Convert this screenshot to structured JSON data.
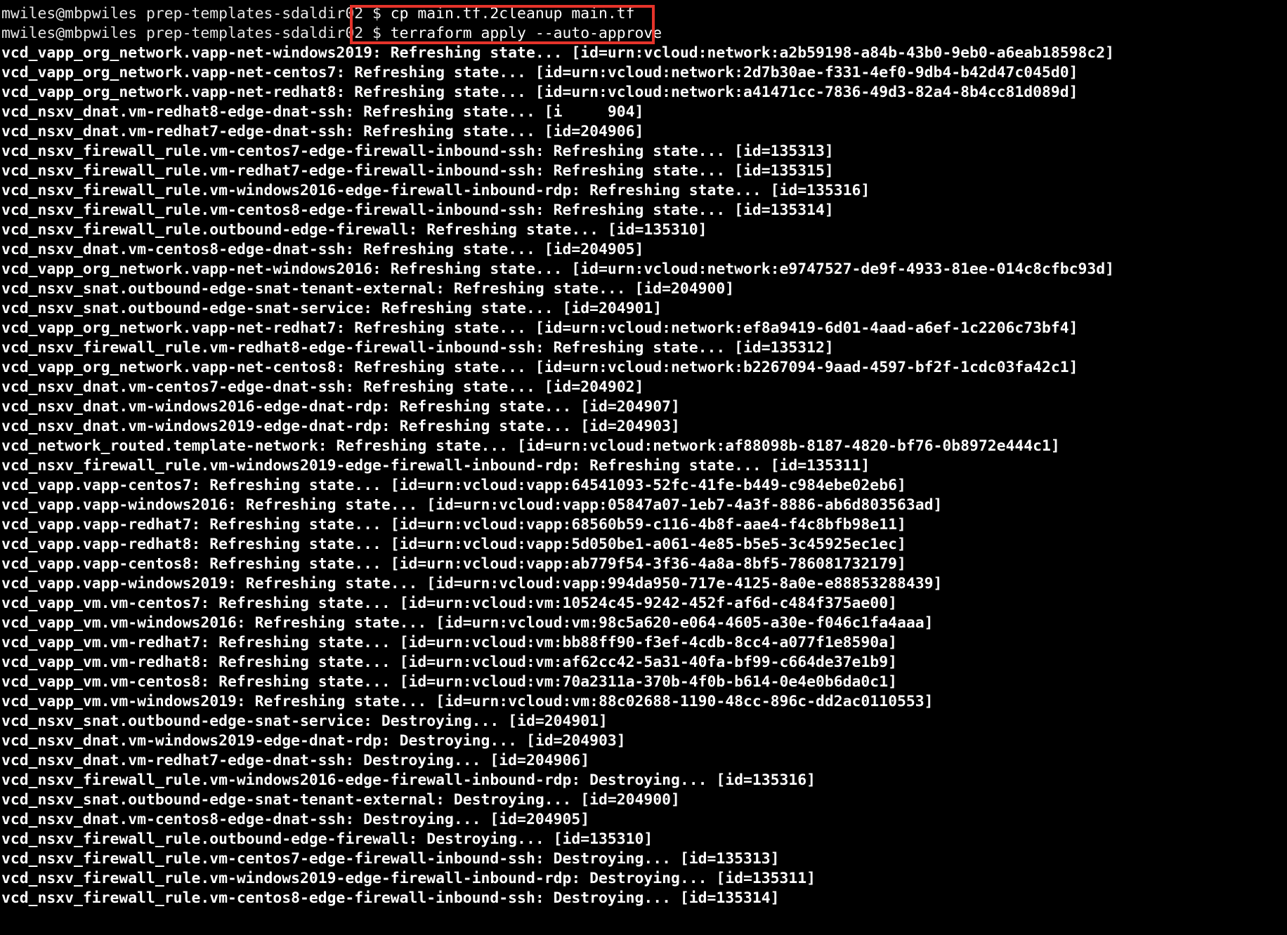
{
  "terminal": {
    "prompt_lines": [
      {
        "prompt": "mwiles@mbpwiles prep-templates-sdaldir02 $ ",
        "command": "cp main.tf.2cleanup main.tf"
      },
      {
        "prompt": "mwiles@mbpwiles prep-templates-sdaldir02 $ ",
        "command": "terraform apply --auto-approve"
      }
    ],
    "output_lines": [
      "vcd_vapp_org_network.vapp-net-windows2019: Refreshing state... [id=urn:vcloud:network:a2b59198-a84b-43b0-9eb0-a6eab18598c2]",
      "vcd_vapp_org_network.vapp-net-centos7: Refreshing state... [id=urn:vcloud:network:2d7b30ae-f331-4ef0-9db4-b42d47c045d0]",
      "vcd_vapp_org_network.vapp-net-redhat8: Refreshing state... [id=urn:vcloud:network:a41471cc-7836-49d3-82a4-8b4cc81d089d]",
      "vcd_nsxv_dnat.vm-redhat8-edge-dnat-ssh: Refreshing state... [i     904]",
      "vcd_nsxv_dnat.vm-redhat7-edge-dnat-ssh: Refreshing state... [id=204906]",
      "vcd_nsxv_firewall_rule.vm-centos7-edge-firewall-inbound-ssh: Refreshing state... [id=135313]",
      "vcd_nsxv_firewall_rule.vm-redhat7-edge-firewall-inbound-ssh: Refreshing state... [id=135315]",
      "vcd_nsxv_firewall_rule.vm-windows2016-edge-firewall-inbound-rdp: Refreshing state... [id=135316]",
      "vcd_nsxv_firewall_rule.vm-centos8-edge-firewall-inbound-ssh: Refreshing state... [id=135314]",
      "vcd_nsxv_firewall_rule.outbound-edge-firewall: Refreshing state... [id=135310]",
      "vcd_nsxv_dnat.vm-centos8-edge-dnat-ssh: Refreshing state... [id=204905]",
      "vcd_vapp_org_network.vapp-net-windows2016: Refreshing state... [id=urn:vcloud:network:e9747527-de9f-4933-81ee-014c8cfbc93d]",
      "vcd_nsxv_snat.outbound-edge-snat-tenant-external: Refreshing state... [id=204900]",
      "vcd_nsxv_snat.outbound-edge-snat-service: Refreshing state... [id=204901]",
      "vcd_vapp_org_network.vapp-net-redhat7: Refreshing state... [id=urn:vcloud:network:ef8a9419-6d01-4aad-a6ef-1c2206c73bf4]",
      "vcd_nsxv_firewall_rule.vm-redhat8-edge-firewall-inbound-ssh: Refreshing state... [id=135312]",
      "vcd_vapp_org_network.vapp-net-centos8: Refreshing state... [id=urn:vcloud:network:b2267094-9aad-4597-bf2f-1cdc03fa42c1]",
      "vcd_nsxv_dnat.vm-centos7-edge-dnat-ssh: Refreshing state... [id=204902]",
      "vcd_nsxv_dnat.vm-windows2016-edge-dnat-rdp: Refreshing state... [id=204907]",
      "vcd_nsxv_dnat.vm-windows2019-edge-dnat-rdp: Refreshing state... [id=204903]",
      "vcd_network_routed.template-network: Refreshing state... [id=urn:vcloud:network:af88098b-8187-4820-bf76-0b8972e444c1]",
      "vcd_nsxv_firewall_rule.vm-windows2019-edge-firewall-inbound-rdp: Refreshing state... [id=135311]",
      "vcd_vapp.vapp-centos7: Refreshing state... [id=urn:vcloud:vapp:64541093-52fc-41fe-b449-c984ebe02eb6]",
      "vcd_vapp.vapp-windows2016: Refreshing state... [id=urn:vcloud:vapp:05847a07-1eb7-4a3f-8886-ab6d803563ad]",
      "vcd_vapp.vapp-redhat7: Refreshing state... [id=urn:vcloud:vapp:68560b59-c116-4b8f-aae4-f4c8bfb98e11]",
      "vcd_vapp.vapp-redhat8: Refreshing state... [id=urn:vcloud:vapp:5d050be1-a061-4e85-b5e5-3c45925ec1ec]",
      "vcd_vapp.vapp-centos8: Refreshing state... [id=urn:vcloud:vapp:ab779f54-3f36-4a8a-8bf5-786081732179]",
      "vcd_vapp.vapp-windows2019: Refreshing state... [id=urn:vcloud:vapp:994da950-717e-4125-8a0e-e88853288439]",
      "vcd_vapp_vm.vm-centos7: Refreshing state... [id=urn:vcloud:vm:10524c45-9242-452f-af6d-c484f375ae00]",
      "vcd_vapp_vm.vm-windows2016: Refreshing state... [id=urn:vcloud:vm:98c5a620-e064-4605-a30e-f046c1fa4aaa]",
      "vcd_vapp_vm.vm-redhat7: Refreshing state... [id=urn:vcloud:vm:bb88ff90-f3ef-4cdb-8cc4-a077f1e8590a]",
      "vcd_vapp_vm.vm-redhat8: Refreshing state... [id=urn:vcloud:vm:af62cc42-5a31-40fa-bf99-c664de37e1b9]",
      "vcd_vapp_vm.vm-centos8: Refreshing state... [id=urn:vcloud:vm:70a2311a-370b-4f0b-b614-0e4e0b6da0c1]",
      "vcd_vapp_vm.vm-windows2019: Refreshing state... [id=urn:vcloud:vm:88c02688-1190-48cc-896c-dd2ac0110553]",
      "vcd_nsxv_snat.outbound-edge-snat-service: Destroying... [id=204901]",
      "vcd_nsxv_dnat.vm-windows2019-edge-dnat-rdp: Destroying... [id=204903]",
      "vcd_nsxv_dnat.vm-redhat7-edge-dnat-ssh: Destroying... [id=204906]",
      "vcd_nsxv_firewall_rule.vm-windows2016-edge-firewall-inbound-rdp: Destroying... [id=135316]",
      "vcd_nsxv_snat.outbound-edge-snat-tenant-external: Destroying... [id=204900]",
      "vcd_nsxv_dnat.vm-centos8-edge-dnat-ssh: Destroying... [id=204905]",
      "vcd_nsxv_firewall_rule.outbound-edge-firewall: Destroying... [id=135310]",
      "vcd_nsxv_firewall_rule.vm-centos7-edge-firewall-inbound-ssh: Destroying... [id=135313]",
      "vcd_nsxv_firewall_rule.vm-windows2019-edge-firewall-inbound-rdp: Destroying... [id=135311]",
      "vcd_nsxv_firewall_rule.vm-centos8-edge-firewall-inbound-ssh: Destroying... [id=135314]"
    ]
  },
  "colors": {
    "background": "#000000",
    "text": "#ffffff",
    "highlight_border": "#e5332a"
  }
}
